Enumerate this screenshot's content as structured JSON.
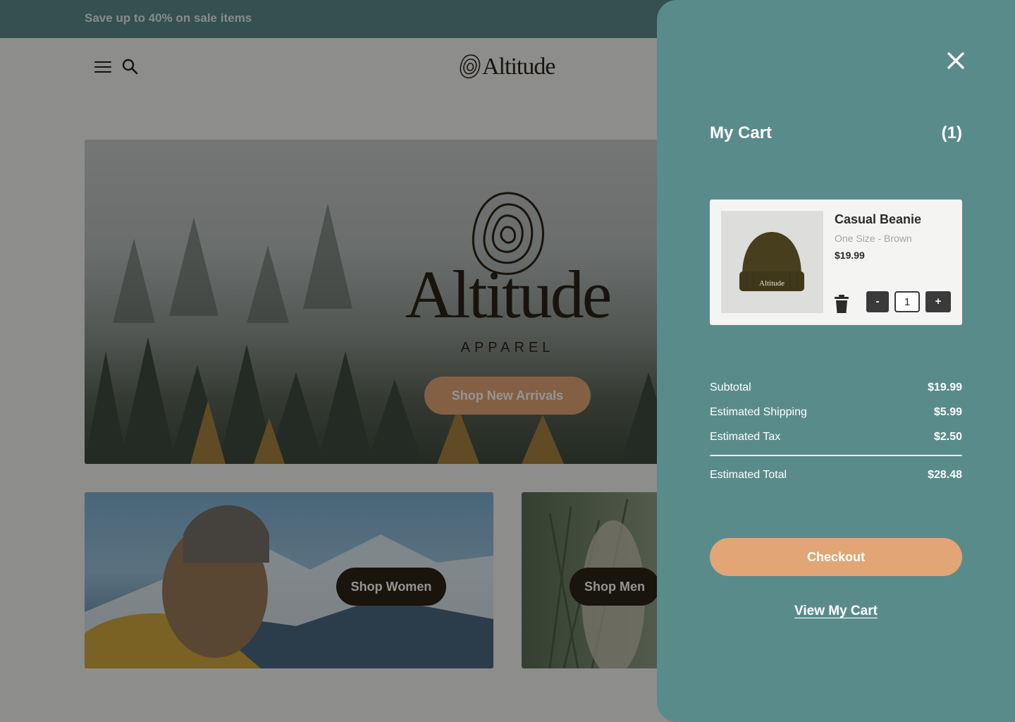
{
  "announcement": {
    "text": "Save up to 40% on sale items"
  },
  "header": {
    "menu_icon": "hamburger-icon",
    "search_icon": "search-icon",
    "logo_text": "Altitude"
  },
  "hero": {
    "logo_text": "Altitude",
    "logo_sub": "APPAREL",
    "button_label": "Shop New Arrivals"
  },
  "categories": [
    {
      "label": "Shop Women"
    },
    {
      "label": "Shop Men"
    }
  ],
  "cart": {
    "title": "My Cart",
    "count": "(1)",
    "close_icon": "close-icon",
    "items": [
      {
        "name": "Casual Beanie",
        "variant": "One Size - Brown",
        "price": "$19.99",
        "image_logo_text": "Altitude",
        "quantity": "1",
        "minus_label": "-",
        "plus_label": "+",
        "delete_icon": "trash-icon"
      }
    ],
    "summary": {
      "subtotal_label": "Subtotal",
      "subtotal_value": "$19.99",
      "shipping_label": "Estimated Shipping",
      "shipping_value": "$5.99",
      "tax_label": "Estimated Tax",
      "tax_value": "$2.50",
      "total_label": "Estimated Total",
      "total_value": "$28.48"
    },
    "checkout_label": "Checkout",
    "view_cart_label": "View My Cart"
  },
  "colors": {
    "teal": "#5a8b8b",
    "accent_orange": "#e2a575",
    "dark_brown": "#2b2415"
  }
}
